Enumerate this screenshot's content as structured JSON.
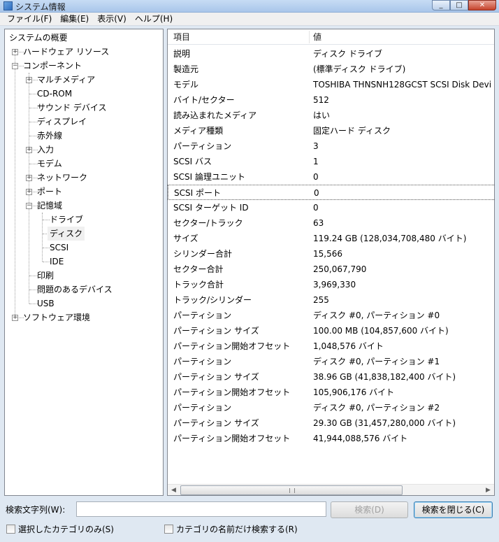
{
  "window": {
    "title": "システム情報"
  },
  "menu": [
    "ファイル(F)",
    "編集(E)",
    "表示(V)",
    "ヘルプ(H)"
  ],
  "tree": {
    "root": "システムの概要",
    "hardware": "ハードウェア リソース",
    "components": "コンポーネント",
    "multimedia": "マルチメディア",
    "cdrom": "CD-ROM",
    "sound": "サウンド デバイス",
    "display": "ディスプレイ",
    "infrared": "赤外線",
    "input": "入力",
    "modem": "モデム",
    "network": "ネットワーク",
    "ports": "ポート",
    "storage": "記憶域",
    "drives": "ドライブ",
    "disks": "ディスク",
    "scsi": "SCSI",
    "ide": "IDE",
    "printing": "印刷",
    "problem": "問題のあるデバイス",
    "usb": "USB",
    "software": "ソフトウェア環境"
  },
  "list": {
    "headers": {
      "item": "項目",
      "value": "値"
    },
    "rows": [
      {
        "item": "説明",
        "value": "ディスク ドライブ"
      },
      {
        "item": "製造元",
        "value": "(標準ディスク ドライブ)"
      },
      {
        "item": "モデル",
        "value": "TOSHIBA THNSNH128GCST SCSI Disk Devi"
      },
      {
        "item": "バイト/セクター",
        "value": "512"
      },
      {
        "item": "読み込まれたメディア",
        "value": "はい"
      },
      {
        "item": "メディア種類",
        "value": "固定ハード ディスク"
      },
      {
        "item": "パーティション",
        "value": "3"
      },
      {
        "item": "SCSI バス",
        "value": "1"
      },
      {
        "item": "SCSI 論理ユニット",
        "value": "0"
      },
      {
        "item": "SCSI ポート",
        "value": "0"
      },
      {
        "item": "SCSI ターゲット ID",
        "value": "0"
      },
      {
        "item": "セクター/トラック",
        "value": "63"
      },
      {
        "item": "サイズ",
        "value": "119.24 GB (128,034,708,480 バイト)"
      },
      {
        "item": "シリンダー合計",
        "value": "15,566"
      },
      {
        "item": "セクター合計",
        "value": "250,067,790"
      },
      {
        "item": "トラック合計",
        "value": "3,969,330"
      },
      {
        "item": "トラック/シリンダー",
        "value": "255"
      },
      {
        "item": "パーティション",
        "value": "ディスク #0, パーティション #0"
      },
      {
        "item": "パーティション サイズ",
        "value": "100.00 MB (104,857,600 バイト)"
      },
      {
        "item": "パーティション開始オフセット",
        "value": "1,048,576 バイト"
      },
      {
        "item": "パーティション",
        "value": "ディスク #0, パーティション #1"
      },
      {
        "item": "パーティション サイズ",
        "value": "38.96 GB (41,838,182,400 バイト)"
      },
      {
        "item": "パーティション開始オフセット",
        "value": "105,906,176 バイト"
      },
      {
        "item": "パーティション",
        "value": "ディスク #0, パーティション #2"
      },
      {
        "item": "パーティション サイズ",
        "value": "29.30 GB (31,457,280,000 バイト)"
      },
      {
        "item": "パーティション開始オフセット",
        "value": "41,944,088,576 バイト"
      }
    ]
  },
  "search": {
    "label": "検索文字列(W):",
    "value": "",
    "find_button": "検索(D)",
    "close_button": "検索を閉じる(C)",
    "chk_selected_only": "選択したカテゴリのみ(S)",
    "chk_names_only": "カテゴリの名前だけ検索する(R)"
  }
}
